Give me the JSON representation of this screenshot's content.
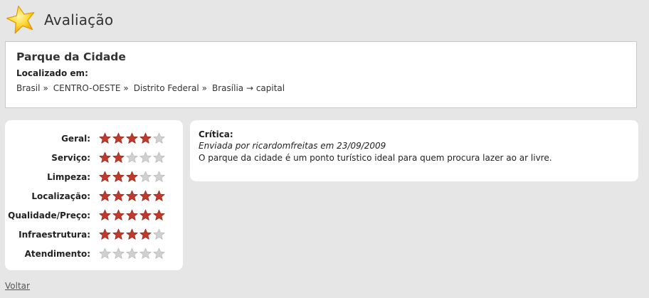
{
  "header": {
    "logo_icon": "star-icon",
    "title": "Avaliação"
  },
  "place": {
    "name": "Parque da Cidade",
    "location_label": "Localizado em:",
    "breadcrumb": [
      {
        "label": "Brasil"
      },
      {
        "label": "CENTRO-OESTE"
      },
      {
        "label": "Distrito Federal"
      },
      {
        "label": "Brasília → capital"
      }
    ],
    "separator": "»"
  },
  "ratings": {
    "max_stars": 5,
    "filled_color": "#c0392b",
    "empty_color": "#d0d0d0",
    "items": [
      {
        "label": "Geral:",
        "stars": 4
      },
      {
        "label": "Serviço:",
        "stars": 2
      },
      {
        "label": "Limpeza:",
        "stars": 3
      },
      {
        "label": "Localização:",
        "stars": 5
      },
      {
        "label": "Qualidade/Preço:",
        "stars": 5
      },
      {
        "label": "Infraestrutura:",
        "stars": 4
      },
      {
        "label": "Atendimento:",
        "stars": 0
      }
    ]
  },
  "review": {
    "title": "Crítica:",
    "meta": "Enviada por ricardomfreitas em 23/09/2009",
    "text": "O parque da cidade é um ponto turístico ideal para quem procura lazer ao ar livre."
  },
  "footer": {
    "back_label": "Voltar"
  }
}
